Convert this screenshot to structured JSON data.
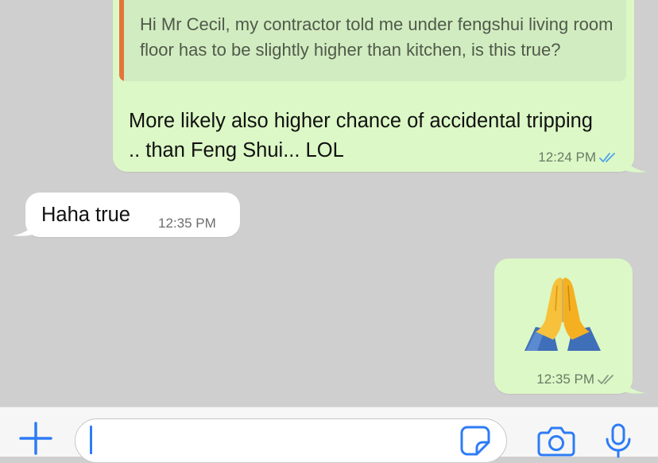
{
  "colors": {
    "chat_background": "#cfcfcf",
    "outgoing_bubble": "#dcf8c6",
    "incoming_bubble": "#ffffff",
    "quote_accent": "#e4743a",
    "read_ticks": "#4fa3e8",
    "delivered_ticks": "#8a9a86",
    "ios_blue": "#2d7cf6"
  },
  "messages": [
    {
      "direction": "outgoing",
      "quote": {
        "text": "Hi Mr Cecil, my contractor told me under fengshui living room floor has to be slightly higher than kitchen, is this true?"
      },
      "text": "More likely also higher chance of accidental tripping .. than Feng Shui... LOL",
      "time": "12:24 PM",
      "status_icon": "double-check-read-icon"
    },
    {
      "direction": "incoming",
      "text": "Haha true",
      "time": "12:35 PM"
    },
    {
      "direction": "outgoing",
      "emoji": "folded-hands",
      "time": "12:35 PM",
      "status_icon": "double-check-delivered-icon"
    }
  ],
  "input_bar": {
    "message_value": "",
    "icons": [
      "plus-icon",
      "sticker-icon",
      "camera-icon",
      "microphone-icon"
    ]
  }
}
